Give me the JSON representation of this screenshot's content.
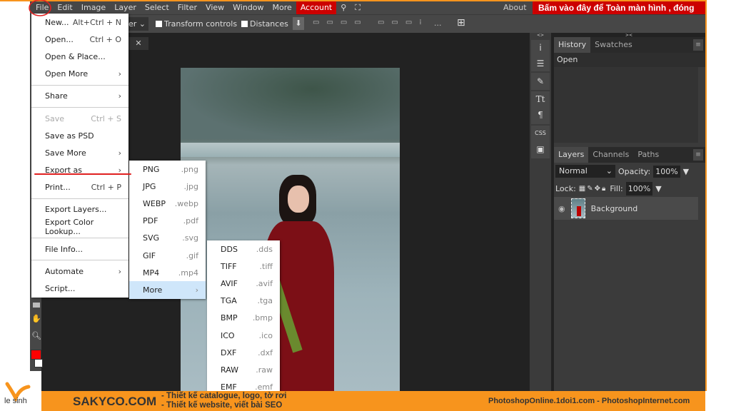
{
  "menubar": {
    "items": [
      "File",
      "Edit",
      "Image",
      "Layer",
      "Select",
      "Filter",
      "View",
      "Window",
      "More"
    ],
    "account": "Account",
    "about": "About",
    "promo": "Bấm vào đây để Toàn màn hình , đóng"
  },
  "options": {
    "dropdown_fragment": "er",
    "transform_controls": "Transform controls",
    "distances": "Distances",
    "more_dots": "..."
  },
  "file_menu": [
    {
      "label": "New...",
      "shortcut": "Alt+Ctrl + N"
    },
    {
      "label": "Open...",
      "shortcut": "Ctrl + O"
    },
    {
      "label": "Open & Place...",
      "shortcut": ""
    },
    {
      "label": "Open More",
      "shortcut": "›"
    },
    {
      "sep": true
    },
    {
      "label": "Share",
      "shortcut": "›"
    },
    {
      "sep": true
    },
    {
      "label": "Save",
      "shortcut": "Ctrl + S",
      "disabled": true
    },
    {
      "label": "Save as PSD",
      "shortcut": ""
    },
    {
      "label": "Save More",
      "shortcut": "›"
    },
    {
      "label": "Export as",
      "shortcut": "›"
    },
    {
      "label": "Print...",
      "shortcut": "Ctrl + P"
    },
    {
      "sep": true
    },
    {
      "label": "Export Layers...",
      "shortcut": ""
    },
    {
      "label": "Export Color Lookup...",
      "shortcut": ""
    },
    {
      "sep": true
    },
    {
      "label": "File Info...",
      "shortcut": ""
    },
    {
      "sep": true
    },
    {
      "label": "Automate",
      "shortcut": "›"
    },
    {
      "label": "Script...",
      "shortcut": ""
    }
  ],
  "export_menu": [
    {
      "label": "PNG",
      "ext": ".png"
    },
    {
      "label": "JPG",
      "ext": ".jpg"
    },
    {
      "label": "WEBP",
      "ext": ".webp"
    },
    {
      "label": "PDF",
      "ext": ".pdf"
    },
    {
      "label": "SVG",
      "ext": ".svg"
    },
    {
      "label": "GIF",
      "ext": ".gif"
    },
    {
      "label": "MP4",
      "ext": ".mp4"
    },
    {
      "label": "More",
      "ext": "›"
    }
  ],
  "more_menu": [
    {
      "label": "DDS",
      "ext": ".dds"
    },
    {
      "label": "TIFF",
      "ext": ".tiff"
    },
    {
      "label": "AVIF",
      "ext": ".avif"
    },
    {
      "label": "TGA",
      "ext": ".tga"
    },
    {
      "label": "BMP",
      "ext": ".bmp"
    },
    {
      "label": "ICO",
      "ext": ".ico"
    },
    {
      "label": "DXF",
      "ext": ".dxf"
    },
    {
      "label": "RAW",
      "ext": ".raw"
    },
    {
      "label": "EMF",
      "ext": ".emf"
    }
  ],
  "history_panel": {
    "tabs": [
      "History",
      "Swatches"
    ],
    "items": [
      "Open"
    ]
  },
  "layers_panel": {
    "tabs": [
      "Layers",
      "Channels",
      "Paths"
    ],
    "blend_mode": "Normal",
    "opacity_label": "Opacity:",
    "opacity": "100%",
    "lock_label": "Lock:",
    "fill_label": "Fill:",
    "fill": "100%",
    "layers": [
      "Background"
    ]
  },
  "right_icons": [
    "i",
    "☰",
    "✎",
    "Tt",
    "¶",
    "CSS",
    "▣"
  ],
  "footer": {
    "brand": "SAKYCO.COM",
    "line1": "- Thiết kế catalogue, logo, tờ rơi",
    "line2": "- Thiết kế website, viết bài SEO",
    "sites": "PhotoshopOnline.1doi1.com - PhotoshopInternet.com",
    "logo_text": "le sinh"
  },
  "colors": {
    "accent_orange": "#f7941d",
    "account_red": "#cc0000",
    "foreground": "#ff0000",
    "background": "#ffffff",
    "annotation": "#e02020"
  }
}
